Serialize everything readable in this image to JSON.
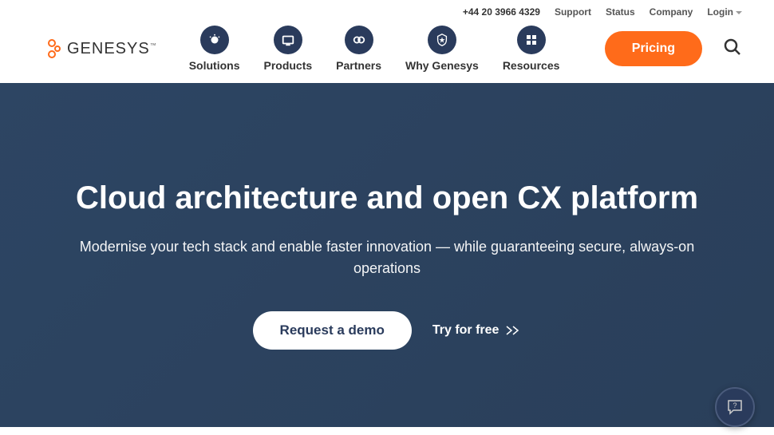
{
  "topbar": {
    "phone": "+44 20 3966 4329",
    "support": "Support",
    "status": "Status",
    "company": "Company",
    "login": "Login"
  },
  "logo": {
    "text": "GENESYS"
  },
  "nav": {
    "solutions": "Solutions",
    "products": "Products",
    "partners": "Partners",
    "why": "Why Genesys",
    "resources": "Resources"
  },
  "pricing": "Pricing",
  "hero": {
    "title": "Cloud architecture and open CX platform",
    "subtitle": "Modernise your tech stack and enable faster innovation — while guaranteeing secure, always-on operations",
    "demo": "Request a demo",
    "try": "Try for free"
  }
}
